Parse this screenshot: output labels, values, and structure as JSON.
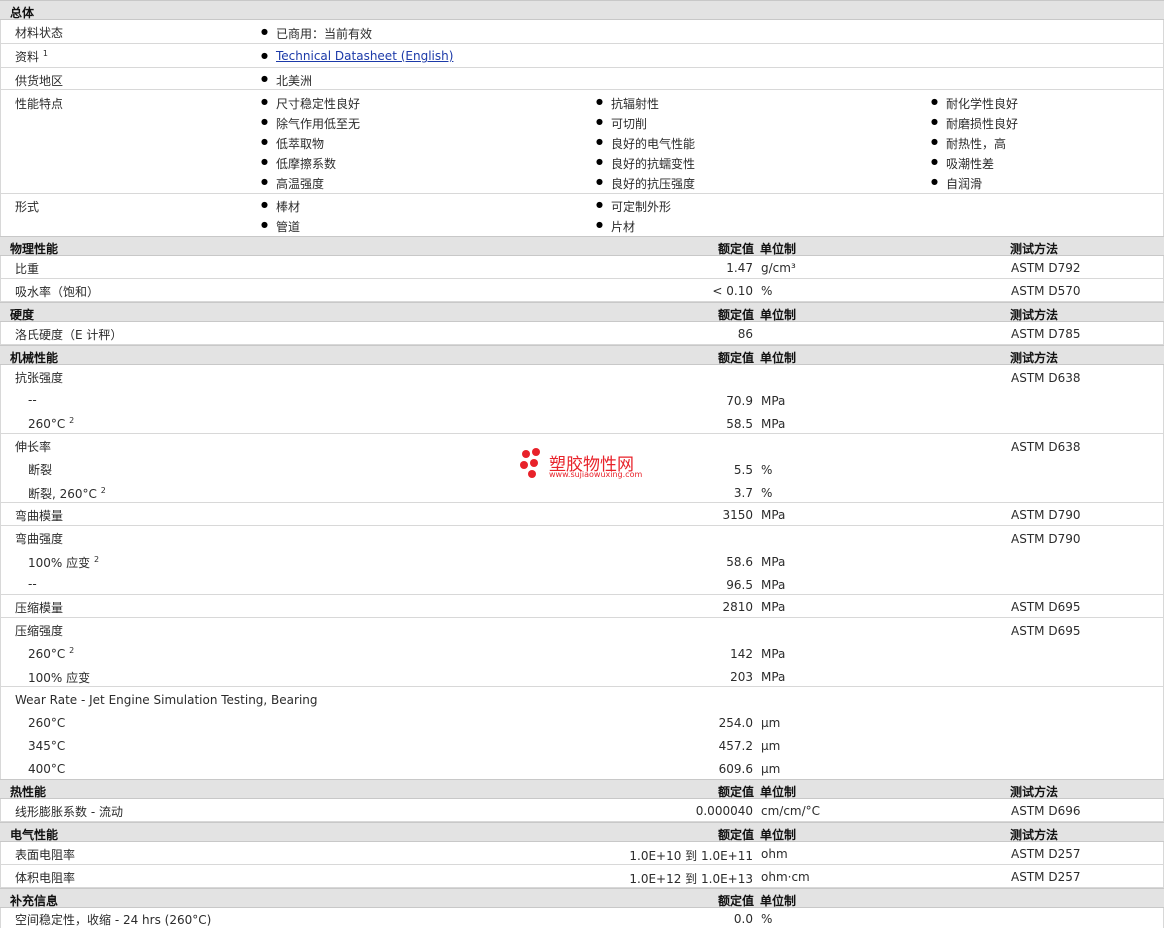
{
  "general": {
    "title": "总体",
    "status": {
      "label": "材料状态",
      "value": "已商用：当前有效"
    },
    "docs": {
      "label": "资料",
      "sup": "1",
      "link": "Technical Datasheet (English)"
    },
    "region": {
      "label": "供货地区",
      "value": "北美洲"
    },
    "features": {
      "label": "性能特点",
      "col1": [
        "尺寸稳定性良好",
        "除气作用低至无",
        "低萃取物",
        "低摩擦系数",
        "高温强度"
      ],
      "col2": [
        "抗辐射性",
        "可切削",
        "良好的电气性能",
        "良好的抗蠕变性",
        "良好的抗压强度"
      ],
      "col3": [
        "耐化学性良好",
        "耐磨损性良好",
        "耐热性，高",
        "吸潮性差",
        "自润滑"
      ]
    },
    "forms": {
      "label": "形式",
      "col1": [
        "棒材",
        "管道"
      ],
      "col2": [
        "可定制外形",
        "片材"
      ]
    }
  },
  "headers": {
    "value": "额定值",
    "unit": "单位制",
    "method": "测试方法"
  },
  "physical": {
    "title": "物理性能",
    "rows": [
      {
        "label": "比重",
        "value": "1.47",
        "unit": "g/cm³",
        "method": "ASTM D792"
      },
      {
        "label": "吸水率（饱和）",
        "value": "< 0.10",
        "unit": "%",
        "method": "ASTM D570"
      }
    ]
  },
  "hardness": {
    "title": "硬度",
    "rows": [
      {
        "label": "洛氏硬度（E 计秤）",
        "value": "86",
        "unit": "",
        "method": "ASTM D785"
      }
    ]
  },
  "mechanical": {
    "title": "机械性能",
    "tensile": {
      "label": "抗张强度",
      "method": "ASTM D638",
      "sub1": {
        "label": "--",
        "value": "70.9",
        "unit": "MPa"
      },
      "sub2": {
        "label": "260°C",
        "sup": "2",
        "value": "58.5",
        "unit": "MPa"
      }
    },
    "elong": {
      "label": "伸长率",
      "method": "ASTM D638",
      "sub1": {
        "label": "断裂",
        "value": "5.5",
        "unit": "%"
      },
      "sub2": {
        "label": "断裂, 260°C",
        "sup": "2",
        "value": "3.7",
        "unit": "%"
      }
    },
    "flexmod": {
      "label": "弯曲模量",
      "value": "3150",
      "unit": "MPa",
      "method": "ASTM D790"
    },
    "flexstr": {
      "label": "弯曲强度",
      "method": "ASTM D790",
      "sub1": {
        "label": "100% 应变",
        "sup": "2",
        "value": "58.6",
        "unit": "MPa"
      },
      "sub2": {
        "label": "--",
        "value": "96.5",
        "unit": "MPa"
      }
    },
    "compmod": {
      "label": "压缩模量",
      "value": "2810",
      "unit": "MPa",
      "method": "ASTM D695"
    },
    "compstr": {
      "label": "压缩强度",
      "method": "ASTM D695",
      "sub1": {
        "label": "260°C",
        "sup": "2",
        "value": "142",
        "unit": "MPa"
      },
      "sub2": {
        "label": "100% 应变",
        "value": "203",
        "unit": "MPa"
      }
    },
    "wear": {
      "label": "Wear Rate - Jet Engine Simulation Testing, Bearing",
      "subs": [
        {
          "label": "260°C",
          "value": "254.0",
          "unit": "µm"
        },
        {
          "label": "345°C",
          "value": "457.2",
          "unit": "µm"
        },
        {
          "label": "400°C",
          "value": "609.6",
          "unit": "µm"
        }
      ]
    }
  },
  "thermal": {
    "title": "热性能",
    "rows": [
      {
        "label": "线形膨胀系数 - 流动",
        "value": "0.000040",
        "unit": "cm/cm/°C",
        "method": "ASTM D696"
      }
    ]
  },
  "electrical": {
    "title": "电气性能",
    "rows": [
      {
        "label": "表面电阻率",
        "value": "1.0E+10 到  1.0E+11",
        "unit": "ohm",
        "method": "ASTM D257"
      },
      {
        "label": "体积电阻率",
        "value": "1.0E+12 到  1.0E+13",
        "unit": "ohm·cm",
        "method": "ASTM D257"
      }
    ]
  },
  "supplement": {
    "title": "补充信息",
    "rows": [
      {
        "label": "空间稳定性，收缩 - 24 hrs (260°C)",
        "value": "0.0",
        "unit": "%"
      }
    ]
  },
  "watermark": {
    "cn": "塑胶物性网",
    "url": "www.sujiaowuxing.com",
    "color": "#e8222a"
  }
}
